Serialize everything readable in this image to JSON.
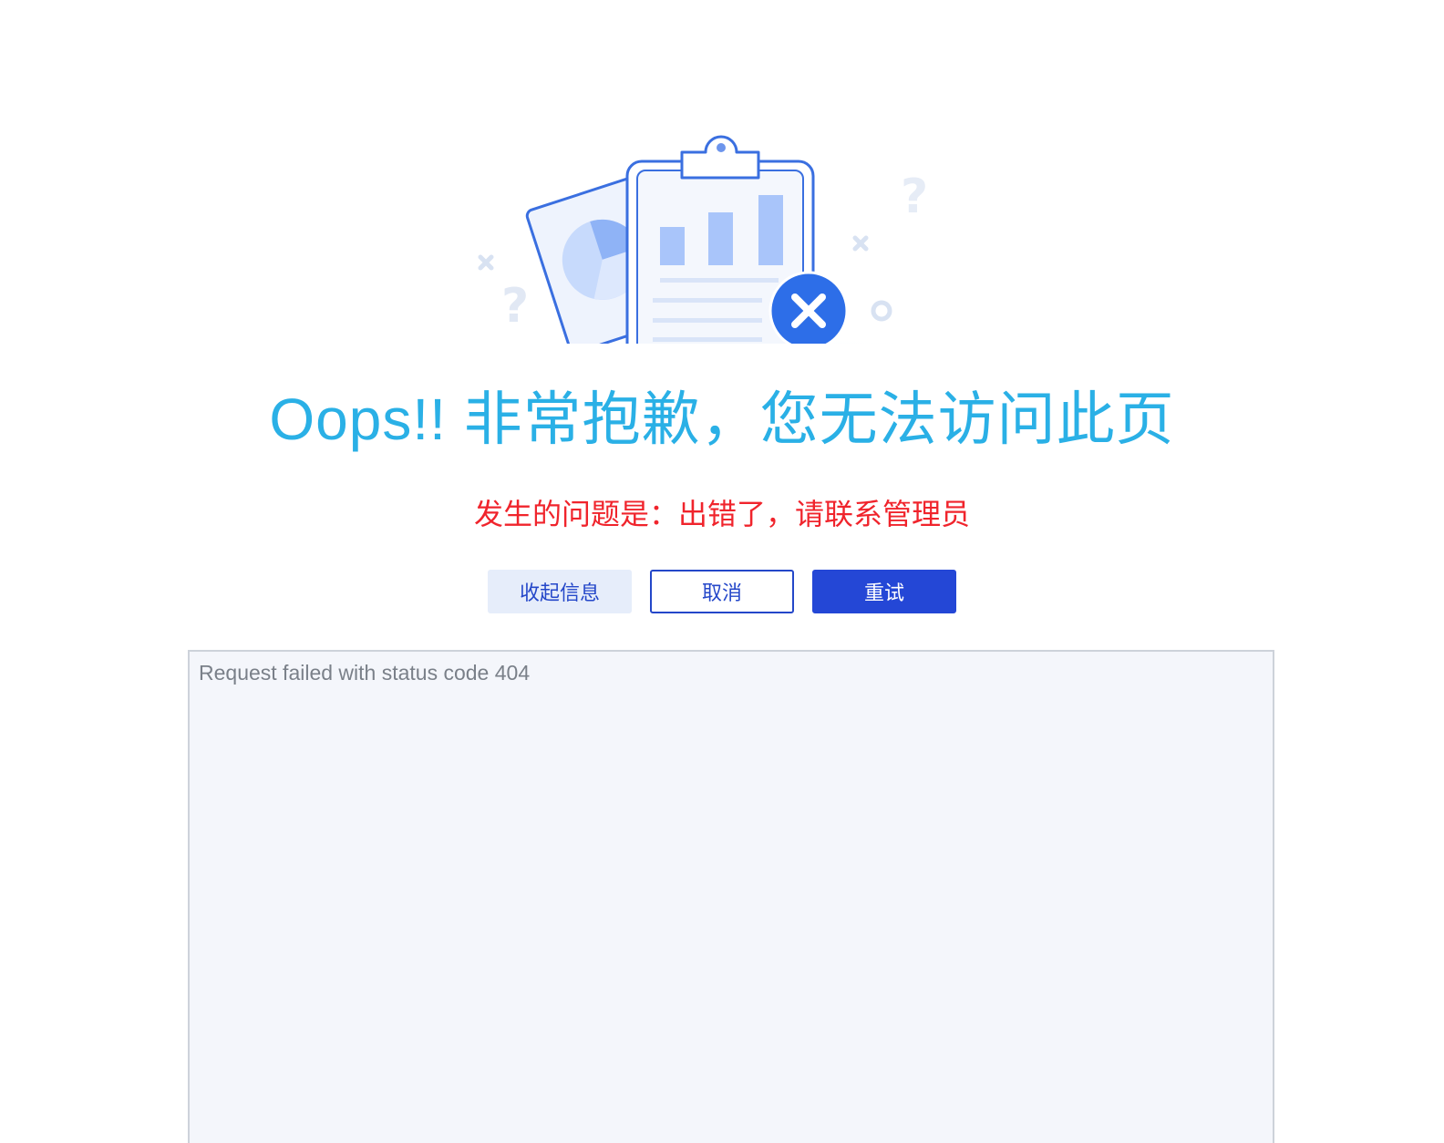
{
  "error": {
    "title": "Oops!!  非常抱歉，您无法访问此页",
    "problem_text": "发生的问题是：出错了，请联系管理员",
    "detail_text": "Request failed with status code 404"
  },
  "buttons": {
    "collapse_label": "收起信息",
    "cancel_label": "取消",
    "retry_label": "重试"
  },
  "illustration": {
    "icon": "error-clipboard-icon"
  },
  "colors": {
    "title": "#2ab0e6",
    "problem": "#f0242c",
    "primary": "#2447d6",
    "collapse_bg": "#e6edfa",
    "detail_bg": "#f4f6fb"
  }
}
